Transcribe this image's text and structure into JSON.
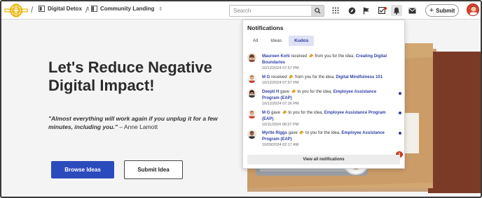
{
  "header": {
    "breadcrumb": [
      {
        "label": "Digital Detox"
      },
      {
        "label": "Community Landing"
      }
    ],
    "search": {
      "placeholder": "Search",
      "value": ""
    },
    "submit_label": "Submit",
    "icons": [
      "grid-icon",
      "compass-icon",
      "flag-icon",
      "checkbox-icon",
      "bell-icon",
      "mail-icon"
    ]
  },
  "hero": {
    "title": "Let's Reduce Negative Digital Impact!",
    "quote": "\"Almost everything will work again if you unplug it for a few minutes, including you.\"",
    "quote_author": " – Anne Lamott",
    "browse_label": "Browse Ideas",
    "submit_idea_label": "Submit Idea"
  },
  "notifications": {
    "title": "Notifications",
    "tabs": [
      {
        "label": "All",
        "active": false
      },
      {
        "label": "Ideas",
        "active": false
      },
      {
        "label": "Kudos",
        "active": true
      }
    ],
    "items": [
      {
        "user": "Maureen Kohl",
        "verb": " received ",
        "mid": " from you for the idea, ",
        "idea": "Creating Digital Boundaries",
        "time": "10/12/2024 07:57 PM",
        "unread": false
      },
      {
        "user": "M G",
        "verb": " received ",
        "mid": " from you for the idea, ",
        "idea": "Digital Mindfulness 101",
        "time": "10/12/2024 07:57 PM",
        "unread": false
      },
      {
        "user": "Deepti H",
        "verb": " gave ",
        "mid": " to you for the idea, ",
        "idea": "Employee Assistance Program (EAP)",
        "time": "10/12/2024 07:26 PM",
        "unread": true
      },
      {
        "user": "M G",
        "verb": " gave ",
        "mid": " to you for the idea, ",
        "idea": "Employee Assistance Program (EAP)",
        "time": "10/11/2024 08:37 PM",
        "unread": true
      },
      {
        "user": "Myrtle Riggs",
        "verb": " gave ",
        "mid": " to you for the idea, ",
        "idea": "Employee Assistance Program (EAP)",
        "time": "10/09/2024 02:17 AM",
        "unread": true
      }
    ],
    "view_all_label": "View all notifications",
    "badge_count": "2"
  },
  "colors": {
    "accent": "#2b4bbd",
    "link": "#2e3fa8",
    "badge": "#c9361e"
  }
}
